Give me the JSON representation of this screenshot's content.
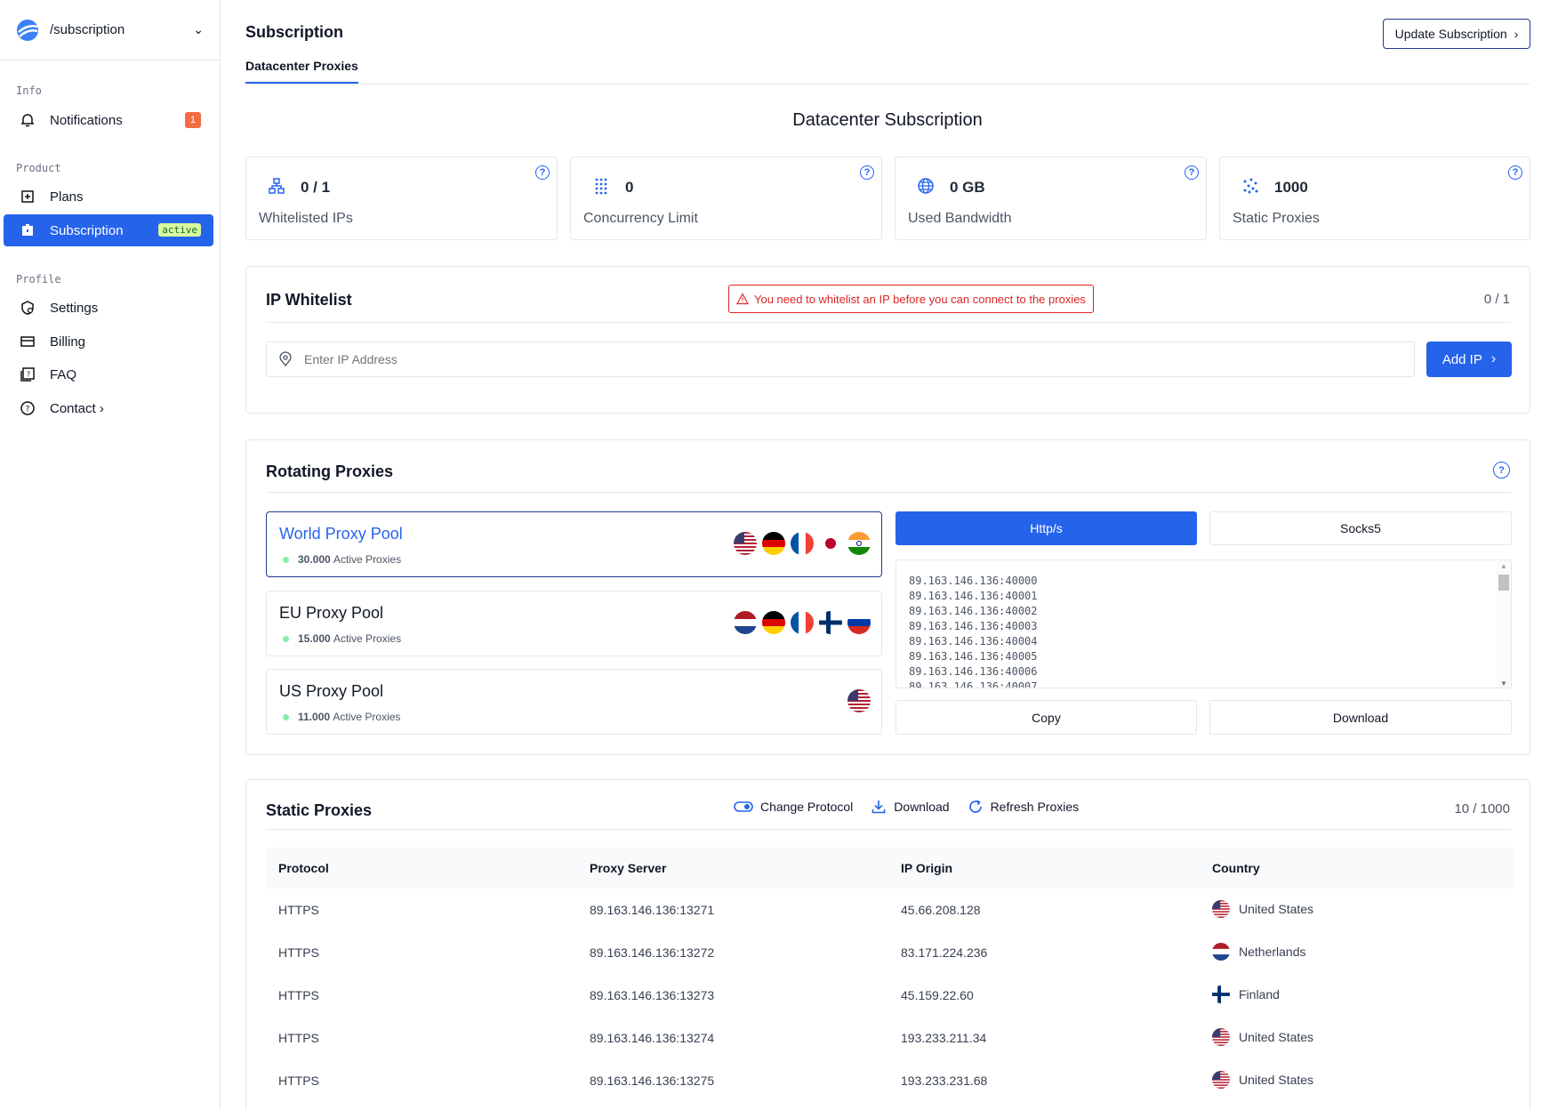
{
  "sidebar": {
    "path": "/subscription",
    "sections": {
      "info": "Info",
      "product": "Product",
      "profile": "Profile"
    },
    "items": {
      "notifications": "Notifications",
      "notifications_count": "1",
      "plans": "Plans",
      "subscription": "Subscription",
      "subscription_badge": "active",
      "settings": "Settings",
      "billing": "Billing",
      "faq": "FAQ",
      "contact": "Contact ›"
    }
  },
  "header": {
    "title": "Subscription",
    "tab": "Datacenter Proxies",
    "update_button": "Update Subscription"
  },
  "subscription_title": "Datacenter Subscription",
  "stats": [
    {
      "value": "0 / 1",
      "label": "Whitelisted IPs",
      "icon": "network-icon"
    },
    {
      "value": "0",
      "label": "Concurrency Limit",
      "icon": "grid-dots-icon"
    },
    {
      "value": "0 GB",
      "label": "Used Bandwidth",
      "icon": "globe-icon"
    },
    {
      "value": "1000",
      "label": "Static Proxies",
      "icon": "scatter-icon"
    }
  ],
  "whitelist": {
    "title": "IP Whitelist",
    "warning": "You need to whitelist an IP before you can connect to the proxies",
    "count": "0 / 1",
    "placeholder": "Enter IP Address",
    "add_button": "Add IP"
  },
  "rotating": {
    "title": "Rotating Proxies",
    "pools": [
      {
        "name": "World Proxy Pool",
        "count": "30.000",
        "suffix": "Active Proxies"
      },
      {
        "name": "EU Proxy Pool",
        "count": "15.000",
        "suffix": "Active Proxies"
      },
      {
        "name": "US Proxy Pool",
        "count": "11.000",
        "suffix": "Active Proxies"
      }
    ],
    "protocol_http": "Http/s",
    "protocol_socks": "Socks5",
    "proxy_list": [
      "89.163.146.136:40000",
      "89.163.146.136:40001",
      "89.163.146.136:40002",
      "89.163.146.136:40003",
      "89.163.146.136:40004",
      "89.163.146.136:40005",
      "89.163.146.136:40006",
      "89.163.146.136:40007"
    ],
    "copy_button": "Copy",
    "download_button": "Download"
  },
  "static": {
    "title": "Static Proxies",
    "change_protocol": "Change Protocol",
    "download": "Download",
    "refresh": "Refresh Proxies",
    "count": "10 / 1000",
    "columns": [
      "Protocol",
      "Proxy Server",
      "IP Origin",
      "Country"
    ],
    "rows": [
      {
        "protocol": "HTTPS",
        "server": "89.163.146.136:13271",
        "origin": "45.66.208.128",
        "country": "United States",
        "flag": "us"
      },
      {
        "protocol": "HTTPS",
        "server": "89.163.146.136:13272",
        "origin": "83.171.224.236",
        "country": "Netherlands",
        "flag": "nl"
      },
      {
        "protocol": "HTTPS",
        "server": "89.163.146.136:13273",
        "origin": "45.159.22.60",
        "country": "Finland",
        "flag": "fi"
      },
      {
        "protocol": "HTTPS",
        "server": "89.163.146.136:13274",
        "origin": "193.233.211.34",
        "country": "United States",
        "flag": "us"
      },
      {
        "protocol": "HTTPS",
        "server": "89.163.146.136:13275",
        "origin": "193.233.231.68",
        "country": "United States",
        "flag": "us"
      }
    ]
  },
  "colors": {
    "accent": "#2563eb",
    "warning": "#dc2626",
    "badge": "#f26b43"
  }
}
